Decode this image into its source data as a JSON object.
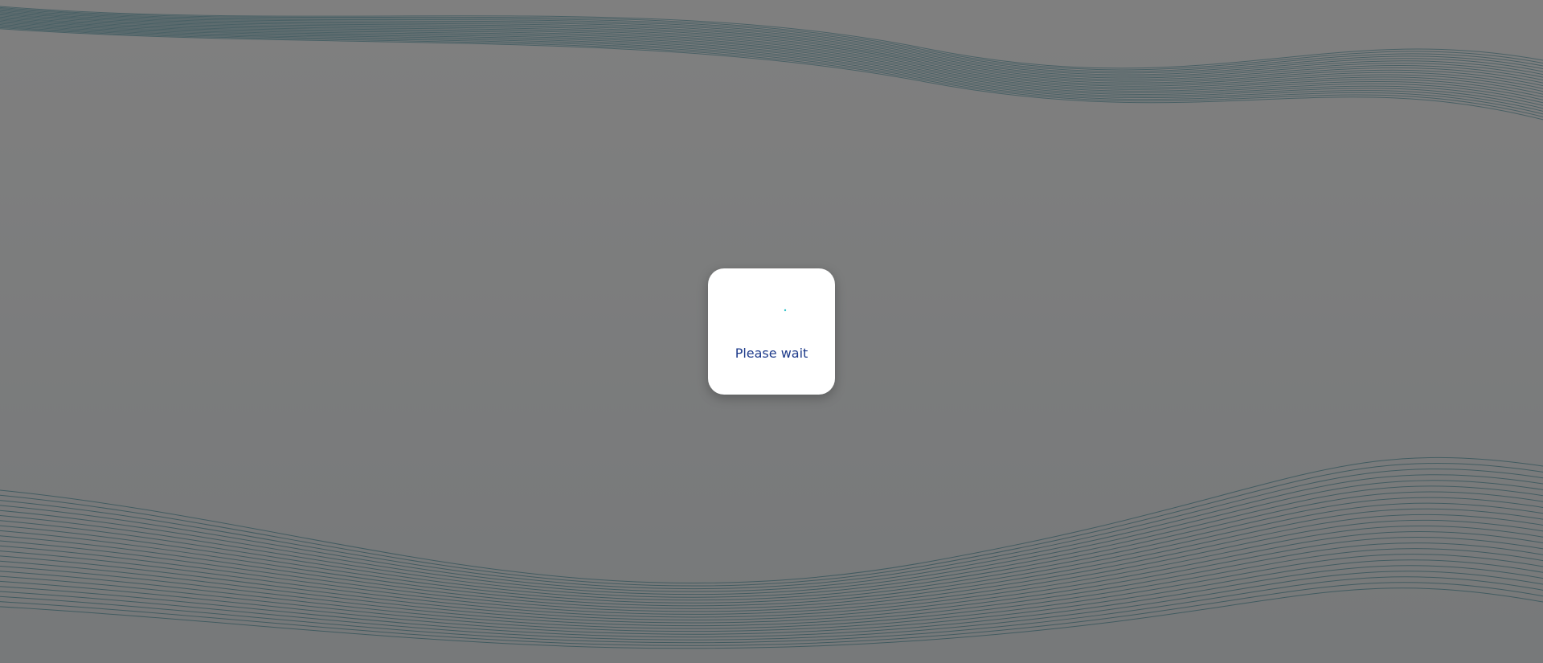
{
  "loading_dialog": {
    "message": "Please wait",
    "spinner_icon": "loading-spinner-icon",
    "message_color": "#1d3a8a",
    "spinner_color": "#34c3c9"
  },
  "background": {
    "overlay_color": "rgba(0,0,0,0.5)",
    "wave_line_color": "#3c8fa0"
  }
}
